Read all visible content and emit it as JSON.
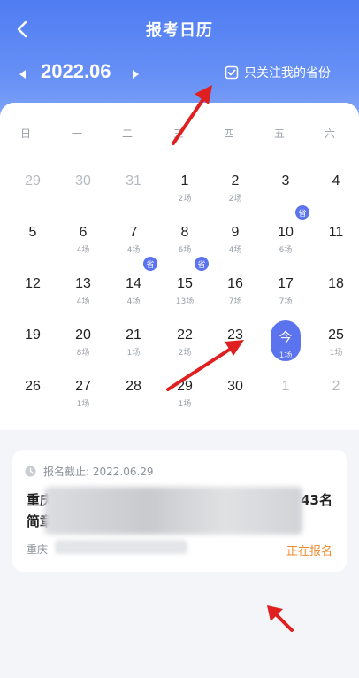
{
  "header": {
    "title": "报考日历",
    "month": "2022.06",
    "filter_label": "只关注我的省份"
  },
  "weekdays": [
    "日",
    "一",
    "二",
    "三",
    "四",
    "五",
    "六"
  ],
  "calendar": {
    "badge_label": "省",
    "days": [
      {
        "num": "29",
        "sub": "",
        "muted": true
      },
      {
        "num": "30",
        "sub": "",
        "muted": true
      },
      {
        "num": "31",
        "sub": "",
        "muted": true
      },
      {
        "num": "1",
        "sub": "2场"
      },
      {
        "num": "2",
        "sub": "2场"
      },
      {
        "num": "3",
        "sub": ""
      },
      {
        "num": "4",
        "sub": ""
      },
      {
        "num": "5",
        "sub": ""
      },
      {
        "num": "6",
        "sub": "4场"
      },
      {
        "num": "7",
        "sub": "4场"
      },
      {
        "num": "8",
        "sub": "6场"
      },
      {
        "num": "9",
        "sub": "4场"
      },
      {
        "num": "10",
        "sub": "6场",
        "badge": true
      },
      {
        "num": "11",
        "sub": ""
      },
      {
        "num": "12",
        "sub": ""
      },
      {
        "num": "13",
        "sub": "4场"
      },
      {
        "num": "14",
        "sub": "4场",
        "badge": true
      },
      {
        "num": "15",
        "sub": "13场",
        "badge": true
      },
      {
        "num": "16",
        "sub": "7场"
      },
      {
        "num": "17",
        "sub": "7场"
      },
      {
        "num": "18",
        "sub": ""
      },
      {
        "num": "19",
        "sub": ""
      },
      {
        "num": "20",
        "sub": "8场"
      },
      {
        "num": "21",
        "sub": "1场"
      },
      {
        "num": "22",
        "sub": "2场"
      },
      {
        "num": "23",
        "sub": ""
      },
      {
        "num": "今",
        "sub": "1场",
        "today": true
      },
      {
        "num": "25",
        "sub": "1场"
      },
      {
        "num": "26",
        "sub": ""
      },
      {
        "num": "27",
        "sub": "1场"
      },
      {
        "num": "28",
        "sub": ""
      },
      {
        "num": "29",
        "sub": "1场"
      },
      {
        "num": "30",
        "sub": ""
      },
      {
        "num": "1",
        "sub": "",
        "muted": true
      },
      {
        "num": "2",
        "sub": "",
        "muted": true
      }
    ]
  },
  "notice": {
    "deadline": "报名截止: 2022.06.29",
    "title_start": "重庆",
    "title_end": "43名",
    "title_line2": "简章",
    "location": "重庆",
    "status": "正在报名"
  },
  "colors": {
    "accent": "#5b73ee",
    "header_top": "#4f7cf2",
    "status": "#ef8a2c",
    "annotation": "#e02020"
  },
  "icons": {
    "back": "chevron-left-icon",
    "prev": "triangle-left-icon",
    "next": "triangle-right-icon",
    "filter": "checkbox-checked-icon",
    "clock": "clock-icon"
  }
}
